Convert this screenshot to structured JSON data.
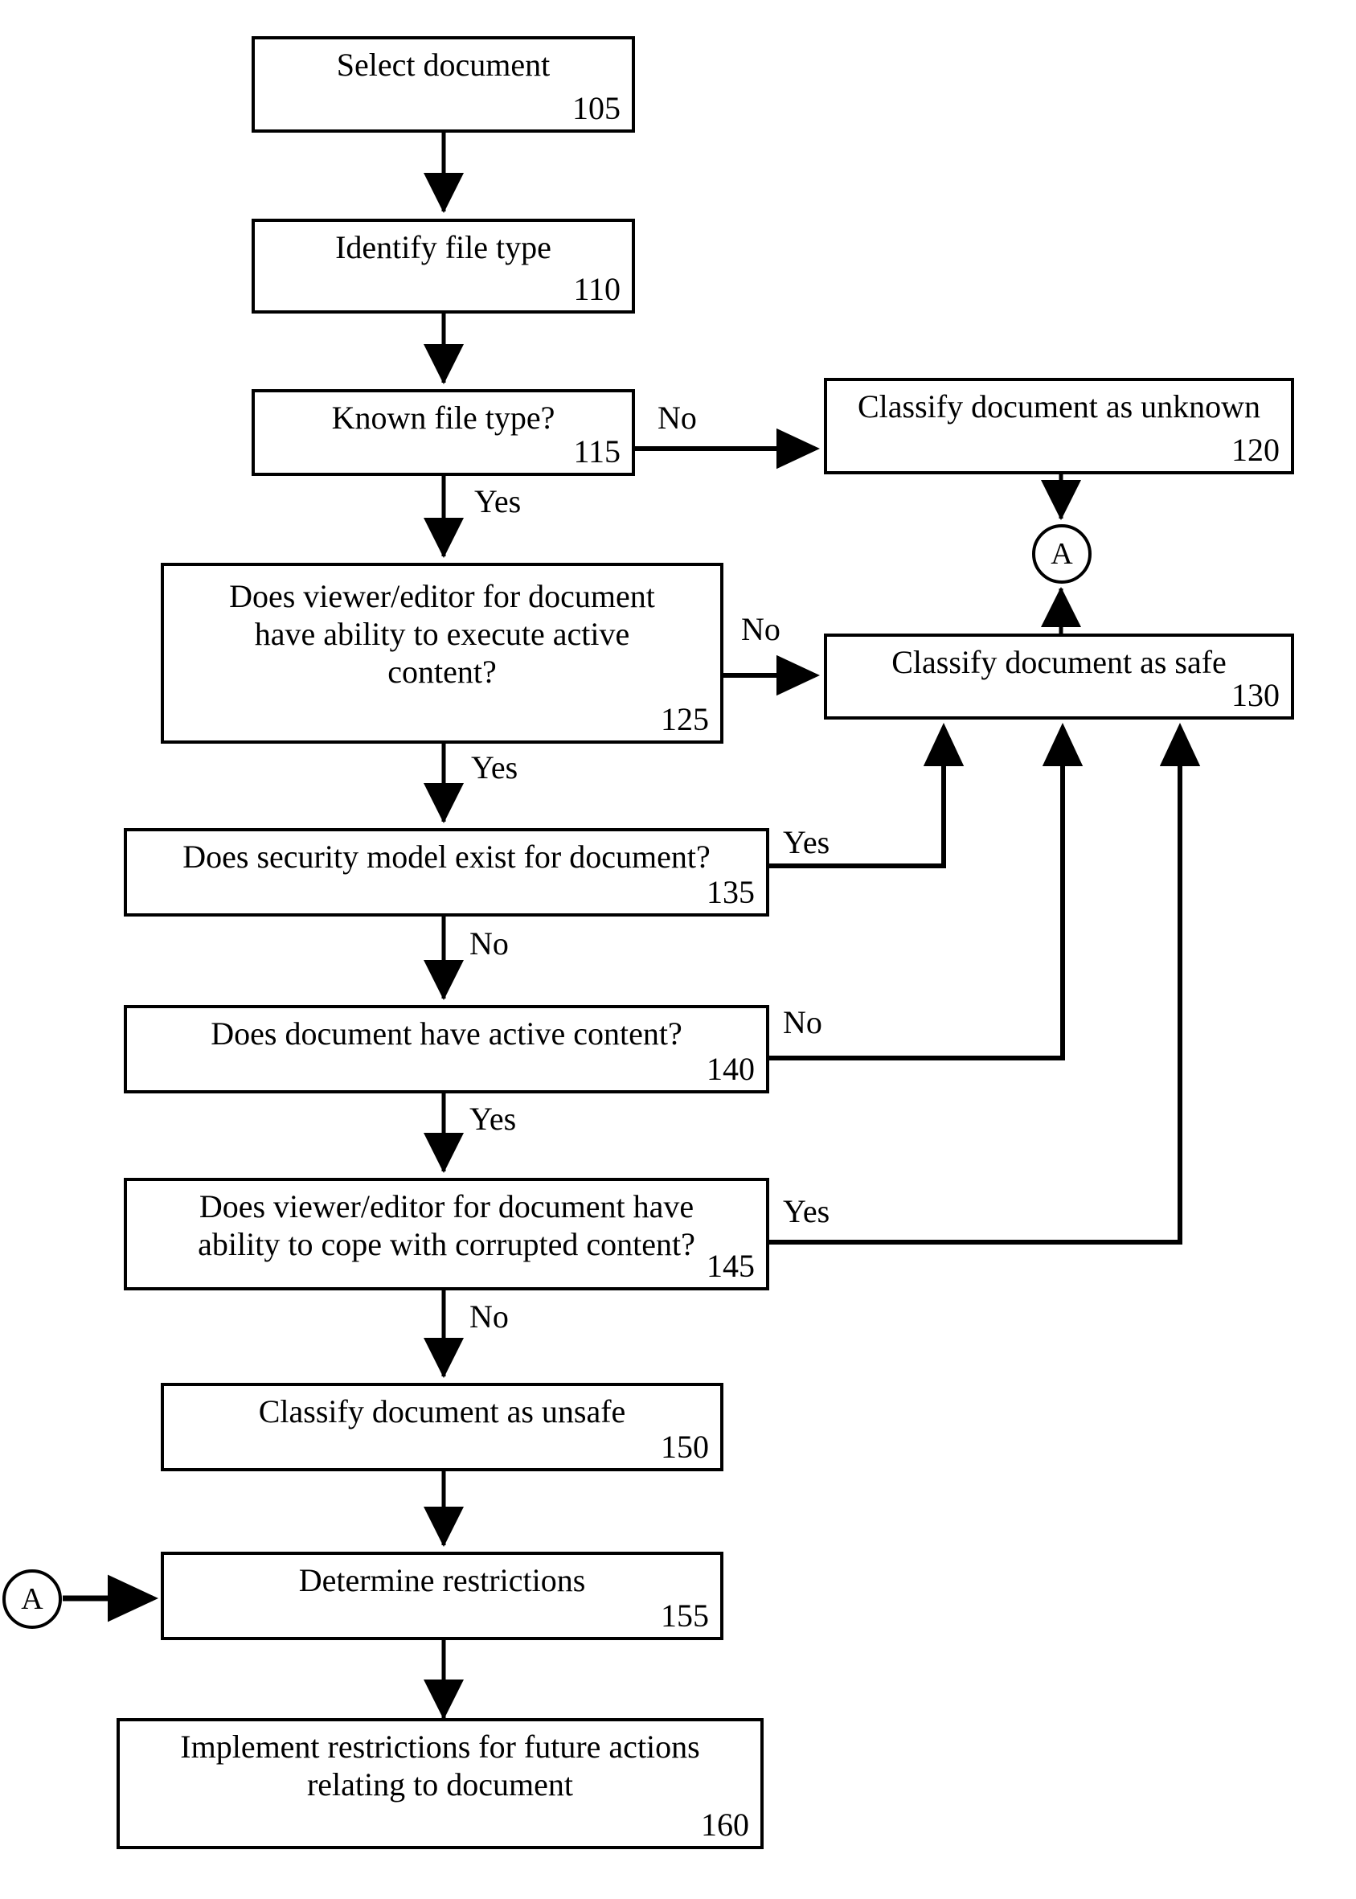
{
  "diagram": {
    "type": "flowchart",
    "title": "Document active-content safety classification flowchart",
    "nodes": [
      {
        "id": "n105",
        "ref": "105",
        "text": "Select document"
      },
      {
        "id": "n110",
        "ref": "110",
        "text": "Identify file type"
      },
      {
        "id": "n115",
        "ref": "115",
        "text": "Known file type?"
      },
      {
        "id": "n120",
        "ref": "120",
        "text": "Classify document as unknown"
      },
      {
        "id": "n125",
        "ref": "125",
        "text": "Does viewer/editor for document\nhave ability to execute active\ncontent?"
      },
      {
        "id": "n130",
        "ref": "130",
        "text": "Classify document as safe"
      },
      {
        "id": "n135",
        "ref": "135",
        "text": "Does security model exist for document?"
      },
      {
        "id": "n140",
        "ref": "140",
        "text": "Does document have active content?"
      },
      {
        "id": "n145",
        "ref": "145",
        "text": "Does viewer/editor for document have\nability to cope with corrupted content?"
      },
      {
        "id": "n150",
        "ref": "150",
        "text": "Classify document as unsafe"
      },
      {
        "id": "n155",
        "ref": "155",
        "text": "Determine restrictions"
      },
      {
        "id": "n160",
        "ref": "160",
        "text": "Implement restrictions for future actions\nrelating to document"
      }
    ],
    "connectors": [
      {
        "id": "cA_top",
        "label": "A"
      },
      {
        "id": "cA_left",
        "label": "A"
      }
    ],
    "edges": [
      {
        "from": "n105",
        "to": "n110",
        "label": ""
      },
      {
        "from": "n110",
        "to": "n115",
        "label": ""
      },
      {
        "from": "n115",
        "to": "n120",
        "label": "No"
      },
      {
        "from": "n115",
        "to": "n125",
        "label": "Yes"
      },
      {
        "from": "n120",
        "to": "cA_top",
        "label": ""
      },
      {
        "from": "n125",
        "to": "n130",
        "label": "No"
      },
      {
        "from": "n125",
        "to": "n135",
        "label": "Yes"
      },
      {
        "from": "n130",
        "to": "cA_top",
        "label": ""
      },
      {
        "from": "n135",
        "to": "n130",
        "label": "Yes"
      },
      {
        "from": "n135",
        "to": "n140",
        "label": "No"
      },
      {
        "from": "n140",
        "to": "n130",
        "label": "No"
      },
      {
        "from": "n140",
        "to": "n145",
        "label": "Yes"
      },
      {
        "from": "n145",
        "to": "n130",
        "label": "Yes"
      },
      {
        "from": "n145",
        "to": "n150",
        "label": "No"
      },
      {
        "from": "n150",
        "to": "n155",
        "label": ""
      },
      {
        "from": "cA_left",
        "to": "n155",
        "label": ""
      },
      {
        "from": "n155",
        "to": "n160",
        "label": ""
      }
    ],
    "edge_labels": {
      "l115_no": "No",
      "l115_yes": "Yes",
      "l125_no": "No",
      "l125_yes": "Yes",
      "l135_yes": "Yes",
      "l135_no": "No",
      "l140_no": "No",
      "l140_yes": "Yes",
      "l145_yes": "Yes",
      "l145_no": "No"
    },
    "colors": {
      "stroke": "#000000",
      "fill": "#ffffff",
      "text": "#000000"
    }
  }
}
